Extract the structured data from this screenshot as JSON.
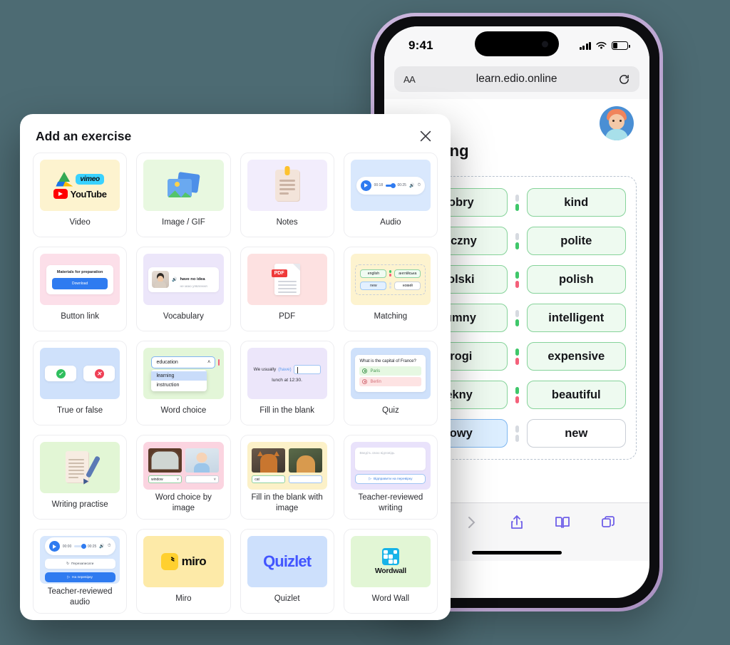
{
  "background_color": "#4d6b73",
  "phone": {
    "status": {
      "time": "9:41",
      "signal_icon": "cellular-bars-icon",
      "wifi_icon": "wifi-icon",
      "battery_icon": "battery-icon"
    },
    "browser": {
      "text_size_label": "AA",
      "url": "learn.edio.online",
      "reload_icon": "reload-icon",
      "toolbar": {
        "back_icon": "chevron-left-icon",
        "forward_icon": "chevron-right-icon",
        "share_icon": "share-icon",
        "bookmarks_icon": "book-icon",
        "tabs_icon": "tabs-icon"
      }
    },
    "page": {
      "avatar": "user-avatar",
      "title": "Matching",
      "pairs": [
        {
          "left": "dobry",
          "right": "kind",
          "left_state": "correct",
          "right_state": "correct",
          "connector": [
            "dim",
            "green"
          ]
        },
        {
          "left": "zeczny",
          "right": "polite",
          "left_state": "correct",
          "right_state": "correct",
          "connector": [
            "dim",
            "green"
          ]
        },
        {
          "left": "polski",
          "right": "polish",
          "left_state": "correct",
          "right_state": "correct",
          "connector": [
            "green",
            "red"
          ]
        },
        {
          "left": "zumny",
          "right": "intelligent",
          "left_state": "correct",
          "right_state": "correct",
          "connector": [
            "dim",
            "green"
          ]
        },
        {
          "left": "drogi",
          "right": "expensive",
          "left_state": "correct",
          "right_state": "correct",
          "connector": [
            "green",
            "red"
          ]
        },
        {
          "left": "iękny",
          "right": "beautiful",
          "left_state": "correct",
          "right_state": "correct",
          "connector": [
            "green",
            "red"
          ]
        },
        {
          "left": "nowy",
          "right": "new",
          "left_state": "selected",
          "right_state": "plain",
          "connector": [
            "dim",
            "dim"
          ]
        }
      ]
    }
  },
  "dialog": {
    "title": "Add an exercise",
    "close_icon": "close-icon",
    "cards": [
      {
        "label": "Video",
        "thumb": "video-logos",
        "tint": "t-yellow",
        "logos": {
          "drive": "google-drive-icon",
          "vimeo": "vimeo",
          "youtube": "YouTube"
        }
      },
      {
        "label": "Image / GIF",
        "thumb": "image-icon",
        "tint": "t-green"
      },
      {
        "label": "Notes",
        "thumb": "notes-icon",
        "tint": "t-purple"
      },
      {
        "label": "Audio",
        "thumb": "audio-player",
        "tint": "t-blue",
        "player": {
          "elapsed": "00:18",
          "total": "00:25",
          "volume_icon": "volume-icon",
          "speed_icon": "speed-icon"
        }
      },
      {
        "label": "Button link",
        "thumb": "button-link",
        "tint": "t-pink",
        "preview": {
          "title": "Materials for preparation",
          "button": "Download"
        }
      },
      {
        "label": "Vocabulary",
        "thumb": "vocabulary-card",
        "tint": "t-lilac",
        "preview": {
          "term": "have no idea",
          "translation": "не маю уявлення",
          "speaker_icon": "speaker-icon"
        }
      },
      {
        "label": "PDF",
        "thumb": "pdf-icon",
        "tint": "t-red",
        "preview": {
          "badge": "PDF"
        }
      },
      {
        "label": "Matching",
        "thumb": "matching-preview",
        "tint": "t-yellow2",
        "preview": {
          "rows": [
            {
              "left": "english",
              "right": "англійська"
            },
            {
              "left": "new",
              "right": "новий"
            }
          ]
        }
      },
      {
        "label": "True or false",
        "thumb": "true-false",
        "tint": "t-bluel",
        "preview": {
          "true_icon": "check-circle-icon",
          "false_icon": "cross-circle-icon"
        }
      },
      {
        "label": "Word choice",
        "thumb": "word-choice",
        "tint": "t-greenl",
        "preview": {
          "selected": "education",
          "options": [
            "learning",
            "instruction"
          ],
          "chevron_icon": "chevron-up-icon"
        }
      },
      {
        "label": "Fill in the blank",
        "thumb": "fill-blank",
        "tint": "t-lilac",
        "preview": {
          "before": "We usually",
          "hint": "(have)",
          "after": "lunch at 12:30."
        }
      },
      {
        "label": "Quiz",
        "thumb": "quiz-preview",
        "tint": "t-bluel",
        "preview": {
          "question": "What is the capital of France?",
          "correct": "Paris",
          "wrong": "Berlin"
        }
      },
      {
        "label": "Writing practise",
        "thumb": "writing-icon",
        "tint": "t-mint"
      },
      {
        "label": "Word choice by image",
        "thumb": "word-choice-image",
        "tint": "t-pinkl",
        "preview": {
          "first": "window",
          "second": ""
        }
      },
      {
        "label": "Fill in the blank with image",
        "thumb": "fill-blank-image",
        "tint": "t-yellowl",
        "preview": {
          "first": "cat",
          "second": ""
        }
      },
      {
        "label": "Teacher-reviewed writing",
        "thumb": "teacher-writing",
        "tint": "t-lilacl",
        "preview": {
          "placeholder": "Введіть свою відповідь",
          "button": "Відправити на перевірку"
        }
      },
      {
        "label": "Teacher-reviewed audio",
        "thumb": "teacher-audio",
        "tint": "t-bluew",
        "preview": {
          "elapsed": "00:00",
          "total": "00:25",
          "rerecord": "Перезаписати",
          "submit": "На перевірку"
        }
      },
      {
        "label": "Miro",
        "thumb": "miro-logo",
        "tint": "t-amber",
        "logo_text": "miro"
      },
      {
        "label": "Quizlet",
        "thumb": "quizlet-logo",
        "tint": "t-blues",
        "logo_text": "Quizlet"
      },
      {
        "label": "Word Wall",
        "thumb": "wordwall-logo",
        "tint": "t-mint",
        "logo_text": "Wordwall"
      }
    ]
  }
}
